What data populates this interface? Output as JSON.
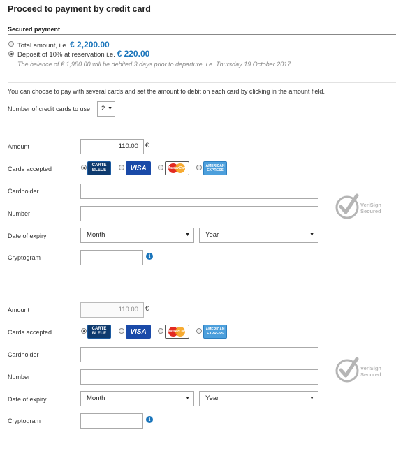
{
  "page": {
    "title": "Proceed to payment by credit card"
  },
  "secured_payment": {
    "heading": "Secured payment",
    "options": [
      {
        "label": "Total amount, i.e.",
        "amount": "€ 2,200.00",
        "selected": false
      },
      {
        "label": "Deposit of 10% at reservation i.e.",
        "amount": "€ 220.00",
        "selected": true
      }
    ],
    "balance_note": "The balance of € 1,980.00 will be debited 3 days prior to departure, i.e. Thursday 19 October 2017."
  },
  "multi_card": {
    "info": "You can choose to pay with several cards and set the amount to debit on each card by clicking in the amount field.",
    "count_label": "Number of credit cards to use",
    "count_value": "2"
  },
  "card_forms": [
    {
      "amount_label": "Amount",
      "amount_value": "110.00",
      "currency": "€",
      "cards_label": "Cards accepted",
      "cards": [
        {
          "name": "CB",
          "line1": "CARTE",
          "line2": "BLEUE",
          "selected": true,
          "icon": "carte-bleue-icon"
        },
        {
          "name": "Visa",
          "text": "VISA",
          "selected": false,
          "icon": "visa-icon"
        },
        {
          "name": "MasterCard",
          "text": "MasterCard",
          "selected": false,
          "icon": "mastercard-icon"
        },
        {
          "name": "American Express",
          "line1": "AMERICAN",
          "line2": "EXPRESS",
          "selected": false,
          "icon": "amex-icon"
        }
      ],
      "cardholder_label": "Cardholder",
      "number_label": "Number",
      "expiry_label": "Date of expiry",
      "month_value": "Month",
      "year_value": "Year",
      "cryptogram_label": "Cryptogram",
      "badge": {
        "line1": "VeriSign",
        "line2": "Secured",
        "icon": "verisign-secured-icon"
      }
    },
    {
      "amount_label": "Amount",
      "amount_value": "110.00",
      "currency": "€",
      "cards_label": "Cards accepted",
      "cards": [
        {
          "name": "CB",
          "line1": "CARTE",
          "line2": "BLEUE",
          "selected": true,
          "icon": "carte-bleue-icon"
        },
        {
          "name": "Visa",
          "text": "VISA",
          "selected": false,
          "icon": "visa-icon"
        },
        {
          "name": "MasterCard",
          "text": "MasterCard",
          "selected": false,
          "icon": "mastercard-icon"
        },
        {
          "name": "American Express",
          "line1": "AMERICAN",
          "line2": "EXPRESS",
          "selected": false,
          "icon": "amex-icon"
        }
      ],
      "cardholder_label": "Cardholder",
      "number_label": "Number",
      "expiry_label": "Date of expiry",
      "month_value": "Month",
      "year_value": "Year",
      "cryptogram_label": "Cryptogram",
      "badge": {
        "line1": "VeriSign",
        "line2": "Secured",
        "icon": "verisign-secured-icon"
      }
    }
  ],
  "colors": {
    "accent": "#1a75bb",
    "divider": "#e2e2e2"
  }
}
